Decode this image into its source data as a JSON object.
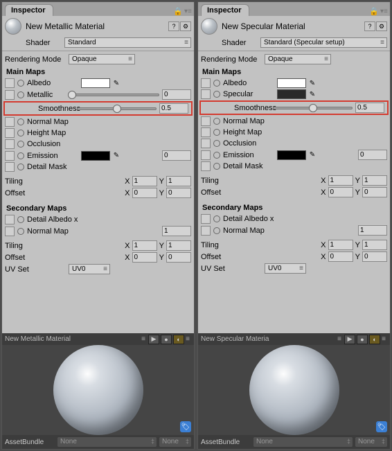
{
  "panels": [
    {
      "tab": "Inspector",
      "material_name": "New Metallic Material",
      "shader_label": "Shader",
      "shader_value": "Standard",
      "rendering_mode_label": "Rendering Mode",
      "rendering_mode_value": "Opaque",
      "main_maps_label": "Main Maps",
      "albedo_label": "Albedo",
      "workflow_label": "Metallic",
      "workflow_value": "0",
      "workflow_slider_pct": 0,
      "workflow_swatch_dark": false,
      "smoothness_label": "Smoothness",
      "smoothness_value": "0.5",
      "normal_label": "Normal Map",
      "height_label": "Height Map",
      "occlusion_label": "Occlusion",
      "emission_label": "Emission",
      "emission_value": "0",
      "detail_mask_label": "Detail Mask",
      "tiling_label": "Tiling",
      "tiling_x": "1",
      "tiling_y": "1",
      "offset_label": "Offset",
      "offset_x": "0",
      "offset_y": "0",
      "secondary_label": "Secondary Maps",
      "detail_albedo_label": "Detail Albedo x",
      "normal2_label": "Normal Map",
      "normal2_value": "1",
      "tiling2_x": "1",
      "tiling2_y": "1",
      "offset2_x": "0",
      "offset2_y": "0",
      "uvset_label": "UV Set",
      "uvset_value": "UV0",
      "preview_name": "New Metallic Material",
      "assetbundle_label": "AssetBundle",
      "assetbundle_value": "None",
      "assetbundle_variant": "None"
    },
    {
      "tab": "Inspector",
      "material_name": "New Specular Material",
      "shader_label": "Shader",
      "shader_value": "Standard (Specular setup)",
      "rendering_mode_label": "Rendering Mode",
      "rendering_mode_value": "Opaque",
      "main_maps_label": "Main Maps",
      "albedo_label": "Albedo",
      "workflow_label": "Specular",
      "workflow_value": "",
      "workflow_slider_pct": null,
      "workflow_swatch_dark": true,
      "smoothness_label": "Smoothness",
      "smoothness_value": "0.5",
      "normal_label": "Normal Map",
      "height_label": "Height Map",
      "occlusion_label": "Occlusion",
      "emission_label": "Emission",
      "emission_value": "0",
      "detail_mask_label": "Detail Mask",
      "tiling_label": "Tiling",
      "tiling_x": "1",
      "tiling_y": "1",
      "offset_label": "Offset",
      "offset_x": "0",
      "offset_y": "0",
      "secondary_label": "Secondary Maps",
      "detail_albedo_label": "Detail Albedo x",
      "normal2_label": "Normal Map",
      "normal2_value": "1",
      "tiling2_x": "1",
      "tiling2_y": "1",
      "offset2_x": "0",
      "offset2_y": "0",
      "uvset_label": "UV Set",
      "uvset_value": "UV0",
      "preview_name": "New Specular Materia",
      "assetbundle_label": "AssetBundle",
      "assetbundle_value": "None",
      "assetbundle_variant": "None"
    }
  ],
  "x_label": "X",
  "y_label": "Y"
}
